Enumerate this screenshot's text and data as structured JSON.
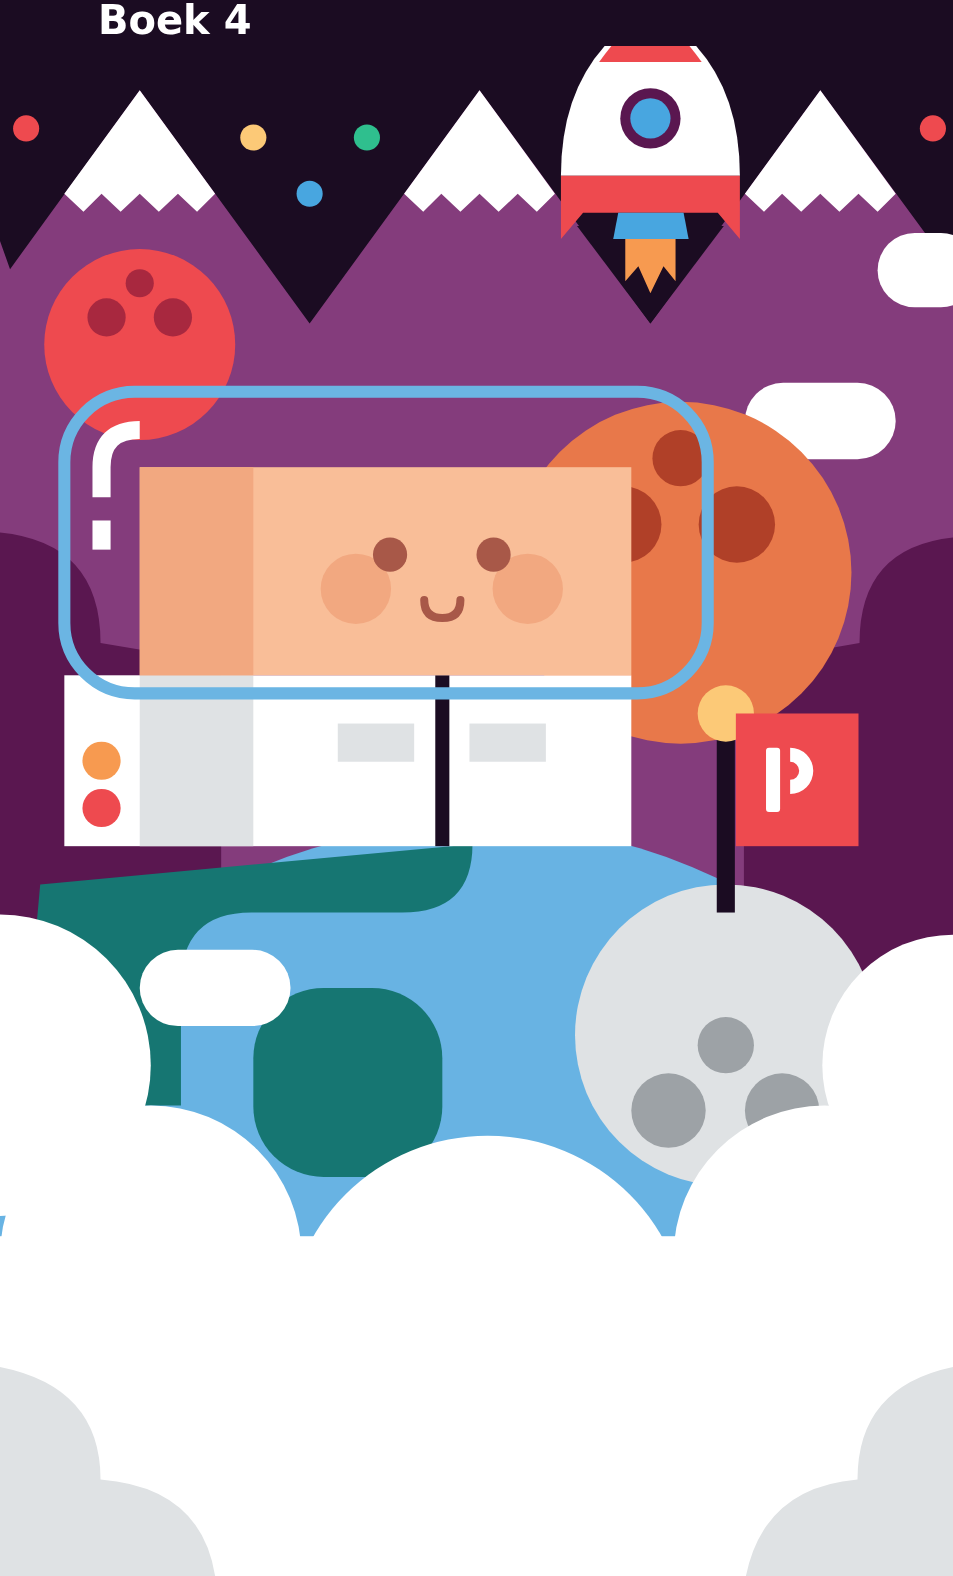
{
  "title": "Boek 4"
}
